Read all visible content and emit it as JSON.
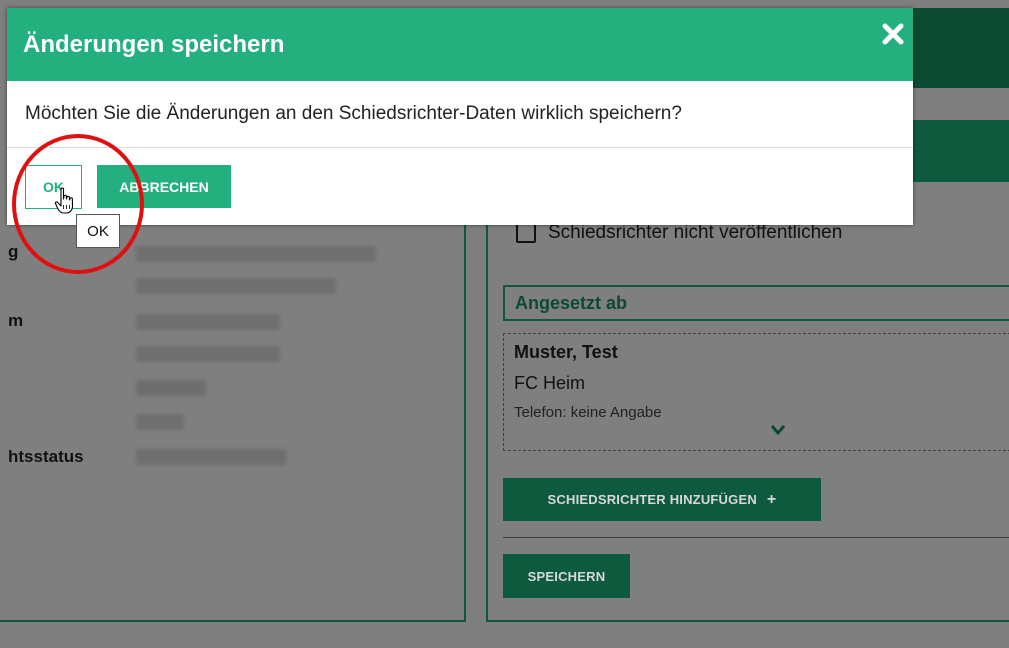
{
  "dialog": {
    "title": "Änderungen speichern",
    "close_icon": "close-icon",
    "message": "Möchten Sie die Änderungen an den Schiedsrichter-Daten wirklich speichern?",
    "ok_label": "OK",
    "cancel_label": "ABBRECHEN",
    "tooltip": "OK"
  },
  "background": {
    "labels": [
      "g",
      "m",
      "htsstatus"
    ],
    "checkbox_label": "Schiedsrichter nicht veröffentlichen",
    "section_title": "Angesetzt ab",
    "referee": {
      "name": "Muster, Test",
      "club": "FC Heim",
      "phone": "Telefon: keine Angabe"
    },
    "add_button": "SCHIEDSRICHTER HINZUFÜGEN",
    "add_icon": "plus-icon",
    "save_button": "SPEICHERN",
    "expand_icon": "chevron-down-icon"
  },
  "colors": {
    "accent": "#23b07e",
    "dark_green": "#0e5a3e",
    "annotation": "#e01010"
  }
}
